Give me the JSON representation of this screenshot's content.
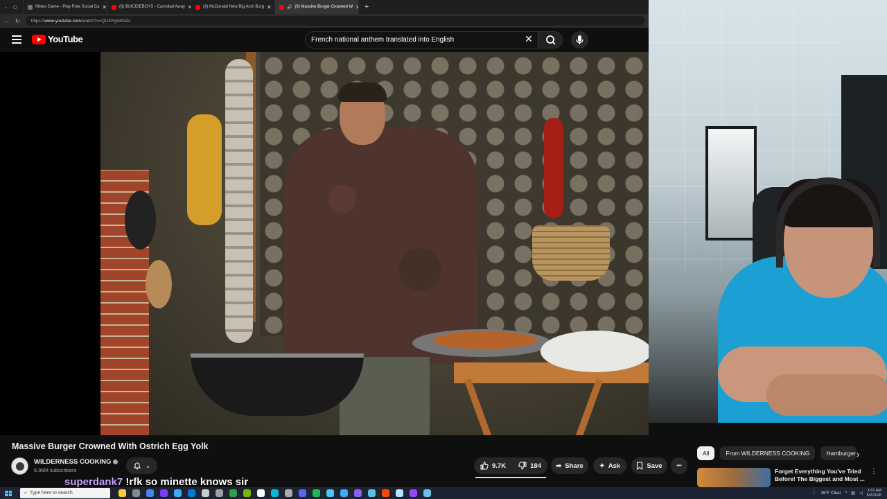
{
  "browser": {
    "tabs": [
      {
        "title": "Mines Game - Play Free Social Ca",
        "color": "#777777",
        "active": false
      },
      {
        "title": "(9) $UICIDEBOYS - Carrollad Away",
        "color": "#ff0000",
        "active": false
      },
      {
        "title": "(9) McDonald New Big Arch Burg",
        "color": "#ff0000",
        "active": false
      },
      {
        "title": "(9) Massive Burger Crowned W",
        "color": "#ff0000",
        "active": true
      }
    ],
    "new_tab": "+",
    "url_prefix": "https://",
    "url_host": "www.youtube.com",
    "url_path": "/watch?v=QlJXFgGK9Zs"
  },
  "youtube": {
    "logo_text": "YouTube",
    "search_query": "French national anthem translated into English",
    "clear_icon": "✕"
  },
  "video": {
    "title": "Massive Burger Crowned With Ostrich Egg Yolk",
    "channel_name": "WILDERNESS COOKING",
    "subscribers": "6.96M subscribers",
    "likes": "9.7K",
    "dislikes": "184",
    "like_ratio": 0.98,
    "share_label": "Share",
    "ask_label": "Ask",
    "save_label": "Save",
    "more_label": "•••"
  },
  "sidebar": {
    "chips": [
      {
        "label": "All",
        "active": true
      },
      {
        "label": "From WILDERNESS COOKING",
        "active": false
      },
      {
        "label": "Hamburger",
        "active": false
      }
    ],
    "chip_next": "›",
    "recommendation": {
      "title": "Forget Everything You've Tried Before! The Biggest and Most ...",
      "more": "⋮"
    }
  },
  "chat": {
    "username": "superdank7",
    "message": "!rfk so minette knows sir"
  },
  "taskbar": {
    "search_placeholder": "Type here to search",
    "weather": "36°F  Clear",
    "time": "1:01 AM",
    "date": "5/2/2026",
    "icon_colors": [
      "#ffcc33",
      "#888888",
      "#4285f4",
      "#7a3cff",
      "#3fa9f5",
      "#0078d4",
      "#cccccc",
      "#9e9e9e",
      "#2ea043",
      "#76b900",
      "#ffffff",
      "#00bcd4",
      "#aaaaaa",
      "#5865f2",
      "#1db954",
      "#4cc2ff",
      "#3fa9f5",
      "#8b5cf6",
      "#5bc0de",
      "#ff4500",
      "#b3e5fc",
      "#9146ff",
      "#66c0f4"
    ]
  }
}
